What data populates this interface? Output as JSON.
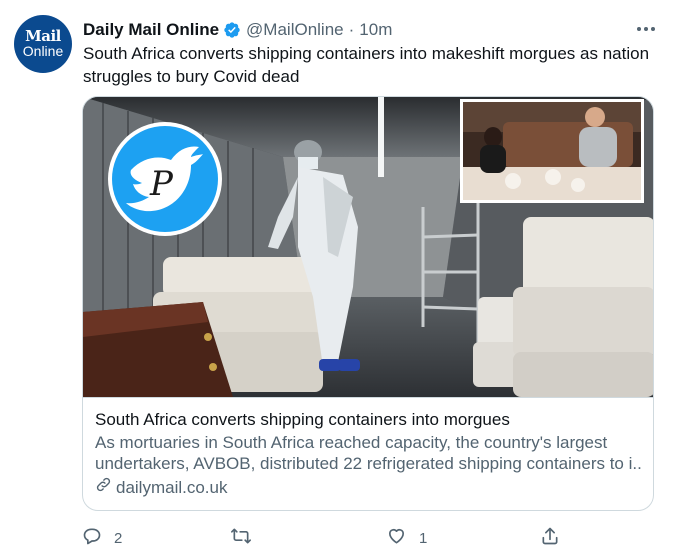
{
  "tweet": {
    "avatar": {
      "line1": "Mail",
      "line2": "Online"
    },
    "author_name": "Daily Mail Online",
    "handle": "@MailOnline",
    "separator": "·",
    "time": "10m",
    "text": "South Africa converts shipping containers into makeshift morgues as nation struggles to bury Covid dead",
    "more_icon": "more-horizontal-icon",
    "card": {
      "title": "South Africa converts shipping containers into morgues",
      "description_lines": [
        "As mortuaries in South Africa reached capacity, the country's largest",
        "undertakers, AVBOB, distributed 22 refrigerated shipping containers to i..."
      ],
      "domain": "dailymail.co.uk"
    },
    "actions": {
      "reply_count": "2",
      "retweet_count": "",
      "like_count": "1"
    }
  },
  "colors": {
    "text_primary": "#0f1419",
    "text_secondary": "#536471",
    "verified_blue": "#1d9bf0",
    "border": "#cfd9de",
    "avatar_bg": "#0b4a8f"
  }
}
